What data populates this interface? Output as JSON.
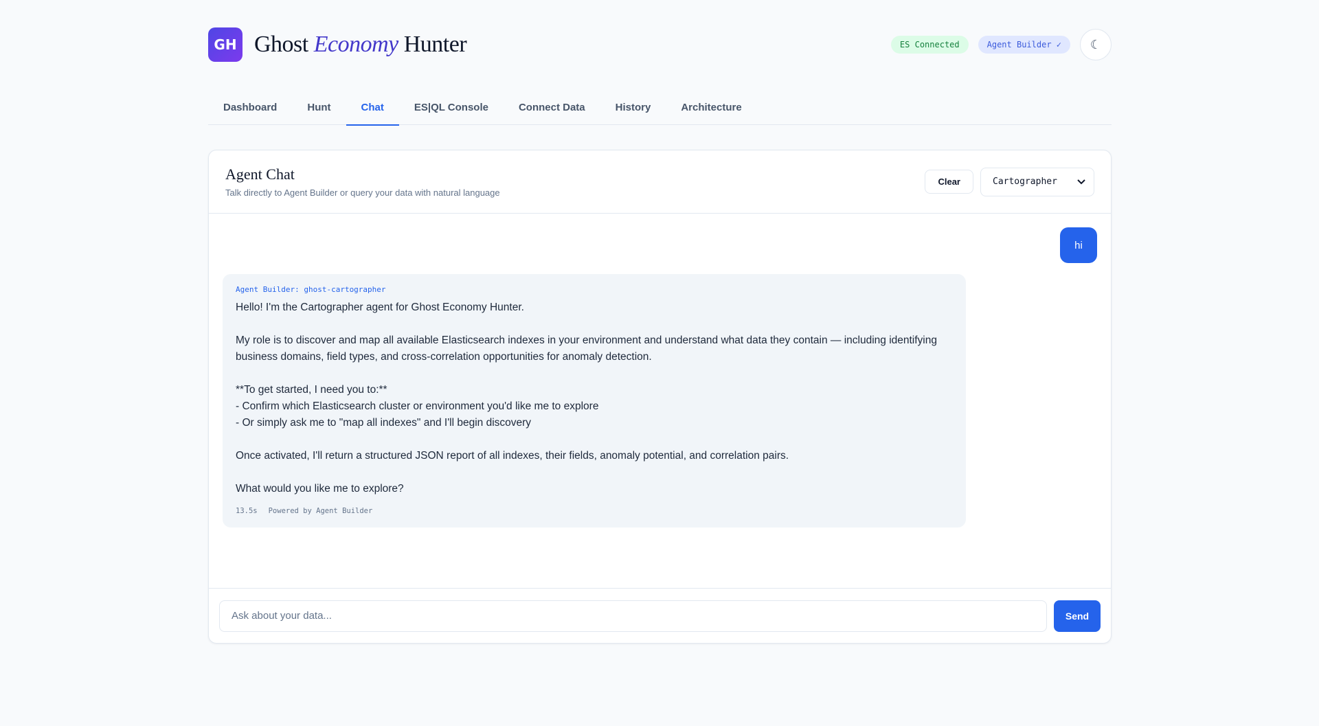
{
  "brand": {
    "logo_text": "GH",
    "title_pre": "Ghost ",
    "title_em": "Economy",
    "title_post": " Hunter"
  },
  "status": {
    "es": "ES Connected",
    "agent_builder": "Agent Builder ✓"
  },
  "theme_toggle": {
    "glyph": "☾"
  },
  "tabs": [
    {
      "label": "Dashboard",
      "active": false
    },
    {
      "label": "Hunt",
      "active": false
    },
    {
      "label": "Chat",
      "active": true
    },
    {
      "label": "ES|QL Console",
      "active": false
    },
    {
      "label": "Connect Data",
      "active": false
    },
    {
      "label": "History",
      "active": false
    },
    {
      "label": "Architecture",
      "active": false
    }
  ],
  "panel": {
    "title": "Agent Chat",
    "subtitle": "Talk directly to Agent Builder or query your data with natural language",
    "clear_label": "Clear",
    "agent_select": {
      "selected": "Cartographer"
    }
  },
  "messages": {
    "user": "hi",
    "agent": {
      "label": "Agent Builder: ghost-cartographer",
      "paragraphs": [
        "Hello! I'm the Cartographer agent for Ghost Economy Hunter.",
        "My role is to discover and map all available Elasticsearch indexes in your environment and understand what data they contain — including identifying business domains, field types, and cross-correlation opportunities for anomaly detection.",
        "**To get started, I need you to:**\n- Confirm which Elasticsearch cluster or environment you'd like me to explore\n- Or simply ask me to \"map all indexes\" and I'll begin discovery",
        "Once activated, I'll return a structured JSON report of all indexes, their fields, anomaly potential, and correlation pairs.",
        "What would you like me to explore?"
      ],
      "duration": "13.5s",
      "powered_by": "Powered by Agent Builder"
    }
  },
  "composer": {
    "placeholder": "Ask about your data...",
    "send_label": "Send"
  }
}
